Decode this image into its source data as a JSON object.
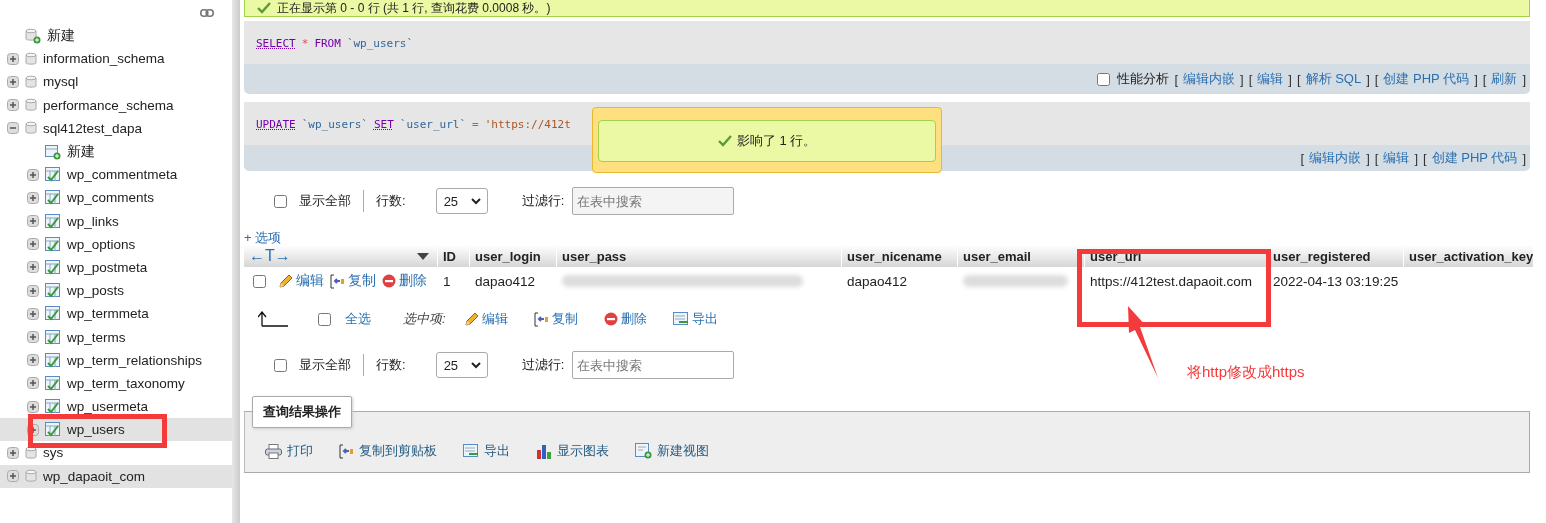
{
  "sidebar": {
    "items": [
      {
        "label": "新建",
        "kind": "new",
        "selected": false
      },
      {
        "label": "information_schema",
        "kind": "database",
        "expanded": false,
        "selected": false
      },
      {
        "label": "mysql",
        "kind": "database",
        "expanded": false,
        "selected": false
      },
      {
        "label": "performance_schema",
        "kind": "database",
        "expanded": false,
        "selected": false
      },
      {
        "label": "sql412test_dapa",
        "kind": "database",
        "expanded": true,
        "selected": false,
        "children": [
          {
            "label": "新建",
            "kind": "new_table",
            "selected": false
          },
          {
            "label": "wp_commentmeta",
            "kind": "table",
            "expanded": false,
            "selected": false
          },
          {
            "label": "wp_comments",
            "kind": "table",
            "expanded": false,
            "selected": false
          },
          {
            "label": "wp_links",
            "kind": "table",
            "expanded": false,
            "selected": false
          },
          {
            "label": "wp_options",
            "kind": "table",
            "expanded": false,
            "selected": false
          },
          {
            "label": "wp_postmeta",
            "kind": "table",
            "expanded": false,
            "selected": false
          },
          {
            "label": "wp_posts",
            "kind": "table",
            "expanded": false,
            "selected": false
          },
          {
            "label": "wp_termmeta",
            "kind": "table",
            "expanded": false,
            "selected": false
          },
          {
            "label": "wp_terms",
            "kind": "table",
            "expanded": false,
            "selected": false
          },
          {
            "label": "wp_term_relationships",
            "kind": "table",
            "expanded": false,
            "selected": false
          },
          {
            "label": "wp_term_taxonomy",
            "kind": "table",
            "expanded": false,
            "selected": false
          },
          {
            "label": "wp_usermeta",
            "kind": "table",
            "expanded": false,
            "selected": false
          },
          {
            "label": "wp_users",
            "kind": "table",
            "expanded": false,
            "selected": true
          }
        ]
      },
      {
        "label": "sys",
        "kind": "database",
        "expanded": false,
        "selected": false
      },
      {
        "label": "wp_dapaoit_com",
        "kind": "database",
        "expanded": false,
        "selected": true
      }
    ]
  },
  "success_banner": "正在显示第 0 - 0 行 (共 1 行, 查询花费 0.0008 秒。)",
  "queries": [
    {
      "tokens": [
        {
          "text": "SELECT",
          "kind": "keyword_link"
        },
        {
          "text": "*",
          "kind": "operator"
        },
        {
          "text": "FROM",
          "kind": "keyword"
        },
        {
          "text": "`wp_users`",
          "kind": "identifier"
        }
      ],
      "profiling": {
        "label": "性能分析",
        "checked": false
      },
      "links": [
        {
          "before": "[",
          "text": "编辑内嵌",
          "after": "]"
        },
        {
          "before": "[",
          "text": "编辑",
          "after": "]"
        },
        {
          "before": "[",
          "text": "解析 SQL",
          "after": "]"
        },
        {
          "before": "[",
          "text": "创建 PHP 代码",
          "after": "]"
        },
        {
          "before": "[",
          "text": "刷新",
          "after": "]"
        }
      ]
    },
    {
      "tokens": [
        {
          "text": "UPDATE",
          "kind": "keyword_link"
        },
        {
          "text": "`wp_users`",
          "kind": "identifier"
        },
        {
          "text": "SET",
          "kind": "keyword_link"
        },
        {
          "text": "`user_url`",
          "kind": "identifier"
        },
        {
          "text": "=",
          "kind": "operator"
        },
        {
          "text": "'https://412t",
          "kind": "string"
        }
      ],
      "links": [
        {
          "before": "[",
          "text": "编辑内嵌",
          "after": "]"
        },
        {
          "before": "[",
          "text": "编辑",
          "after": "]"
        },
        {
          "before": "[",
          "text": "创建 PHP 代码",
          "after": "]"
        }
      ]
    }
  ],
  "toast": "影响了 1 行。",
  "navigation": [
    {
      "show_all": {
        "label": "显示全部",
        "checked": false
      },
      "rows_label": "行数:",
      "rows_value": "25",
      "filter_label": "过滤行:",
      "filter_placeholder": "在表中搜索"
    },
    {
      "show_all": {
        "label": "显示全部",
        "checked": false
      },
      "rows_label": "行数:",
      "rows_value": "25",
      "filter_label": "过滤行:",
      "filter_placeholder": "在表中搜索"
    }
  ],
  "options_link": "+ 选项",
  "table": {
    "sort_arrows": "←T→",
    "columns": [
      "ID",
      "user_login",
      "user_pass",
      "user_nicename",
      "user_email",
      "user_url",
      "user_registered",
      "user_activation_key"
    ],
    "rows": [
      {
        "checked": false,
        "actions": [
          {
            "label": "编辑",
            "kind": "edit"
          },
          {
            "label": "复制",
            "kind": "copy"
          },
          {
            "label": "删除",
            "kind": "delete"
          }
        ],
        "cells": [
          {
            "kind": "text",
            "text": "1"
          },
          {
            "kind": "text",
            "text": "dapao412"
          },
          {
            "kind": "redacted"
          },
          {
            "kind": "text",
            "text": "dapao412"
          },
          {
            "kind": "redacted"
          },
          {
            "kind": "text",
            "text": "https://412test.dapaoit.com"
          },
          {
            "kind": "text",
            "text": "2022-04-13 03:19:25"
          },
          {
            "kind": "text",
            "text": ""
          }
        ]
      }
    ]
  },
  "bulk": {
    "check_all": {
      "label": "全选",
      "checked": false
    },
    "with_selected": "选中项:",
    "actions": [
      {
        "label": "编辑",
        "kind": "edit"
      },
      {
        "label": "复制",
        "kind": "copy"
      },
      {
        "label": "删除",
        "kind": "delete"
      },
      {
        "label": "导出",
        "kind": "export"
      }
    ]
  },
  "result_operations": {
    "legend": "查询结果操作",
    "items": [
      {
        "label": "打印",
        "kind": "print"
      },
      {
        "label": "复制到剪贴板",
        "kind": "copy"
      },
      {
        "label": "导出",
        "kind": "export"
      },
      {
        "label": "显示图表",
        "kind": "chart"
      },
      {
        "label": "新建视图",
        "kind": "new_view"
      }
    ]
  },
  "annotation_note": "将http修改成https"
}
